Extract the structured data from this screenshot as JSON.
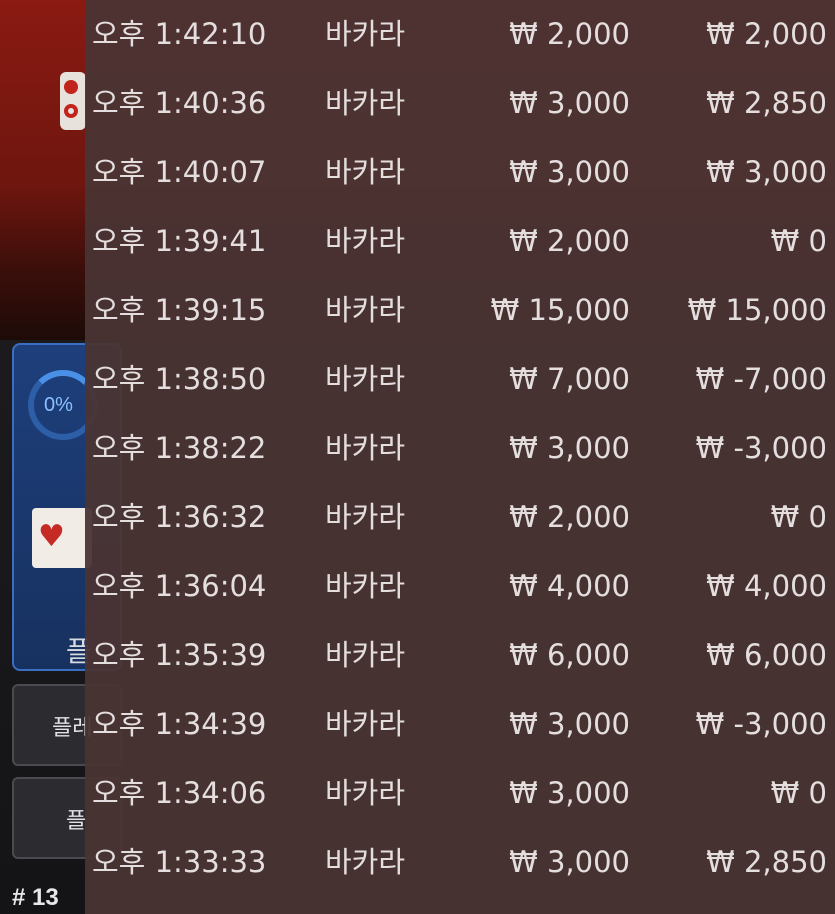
{
  "background": {
    "progress_label": "0%",
    "panel_label": "플",
    "buttons": [
      {
        "label": "플레"
      },
      {
        "label": "플"
      }
    ],
    "round_label": "# 13"
  },
  "history": {
    "rows": [
      {
        "time": "오후 1:42:10",
        "game": "바카라",
        "bet": "₩ 2,000",
        "result": "₩ 2,000"
      },
      {
        "time": "오후 1:40:36",
        "game": "바카라",
        "bet": "₩ 3,000",
        "result": "₩ 2,850"
      },
      {
        "time": "오후 1:40:07",
        "game": "바카라",
        "bet": "₩ 3,000",
        "result": "₩ 3,000"
      },
      {
        "time": "오후 1:39:41",
        "game": "바카라",
        "bet": "₩ 2,000",
        "result": "₩ 0"
      },
      {
        "time": "오후 1:39:15",
        "game": "바카라",
        "bet": "₩ 15,000",
        "result": "₩ 15,000"
      },
      {
        "time": "오후 1:38:50",
        "game": "바카라",
        "bet": "₩ 7,000",
        "result": "₩ -7,000"
      },
      {
        "time": "오후 1:38:22",
        "game": "바카라",
        "bet": "₩ 3,000",
        "result": "₩ -3,000"
      },
      {
        "time": "오후 1:36:32",
        "game": "바카라",
        "bet": "₩ 2,000",
        "result": "₩ 0"
      },
      {
        "time": "오후 1:36:04",
        "game": "바카라",
        "bet": "₩ 4,000",
        "result": "₩ 4,000"
      },
      {
        "time": "오후 1:35:39",
        "game": "바카라",
        "bet": "₩ 6,000",
        "result": "₩ 6,000"
      },
      {
        "time": "오후 1:34:39",
        "game": "바카라",
        "bet": "₩ 3,000",
        "result": "₩ -3,000"
      },
      {
        "time": "오후 1:34:06",
        "game": "바카라",
        "bet": "₩ 3,000",
        "result": "₩ 0"
      },
      {
        "time": "오후 1:33:33",
        "game": "바카라",
        "bet": "₩ 3,000",
        "result": "₩ 2,850"
      }
    ]
  }
}
